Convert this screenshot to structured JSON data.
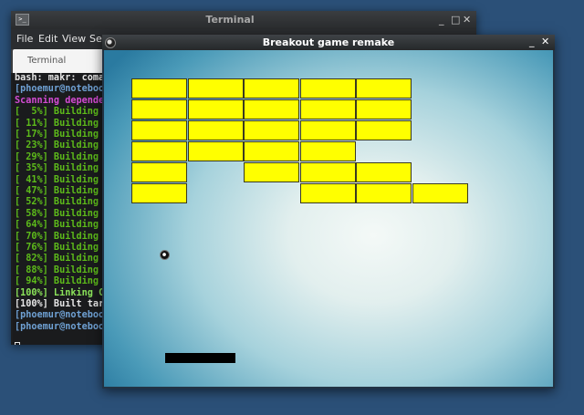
{
  "terminal": {
    "title": "Terminal",
    "minimize_icon": "_",
    "maximize_icon": "□",
    "close_icon": "✕",
    "app_icon_glyph": ">_",
    "menu": [
      "File",
      "Edit",
      "View",
      "Se"
    ],
    "tab_label": "Terminal",
    "lines": [
      "bash: makr: coma",
      "[phoemur@noteboo",
      "Scanning depende",
      "[  5%] Building",
      "[ 11%] Building",
      "[ 17%] Building",
      "[ 23%] Building",
      "[ 29%] Building",
      "[ 35%] Building",
      "[ 41%] Building",
      "[ 47%] Building",
      "[ 52%] Building",
      "[ 58%] Building",
      "[ 64%] Building",
      "[ 70%] Building",
      "[ 76%] Building",
      "[ 82%] Building",
      "[ 88%] Building",
      "[ 94%] Building",
      "[100%] Linking C",
      "[100%] Built tar",
      "[phoemur@noteboo",
      "[phoemur@noteboo"
    ]
  },
  "game": {
    "title": "Breakout game remake",
    "minimize_icon": "_",
    "close_icon": "✕",
    "brick_color": "#ffff00",
    "ball_color": "#000000",
    "paddle_color": "#000000",
    "bricks": [
      [
        1,
        1,
        1,
        1,
        1,
        0
      ],
      [
        1,
        1,
        1,
        1,
        1,
        0
      ],
      [
        1,
        1,
        1,
        1,
        1,
        0
      ],
      [
        1,
        1,
        1,
        1,
        0,
        0
      ],
      [
        1,
        0,
        1,
        1,
        1,
        0
      ],
      [
        1,
        0,
        0,
        1,
        1,
        1
      ]
    ]
  },
  "desktop": {
    "background_color": "#2b5078"
  }
}
